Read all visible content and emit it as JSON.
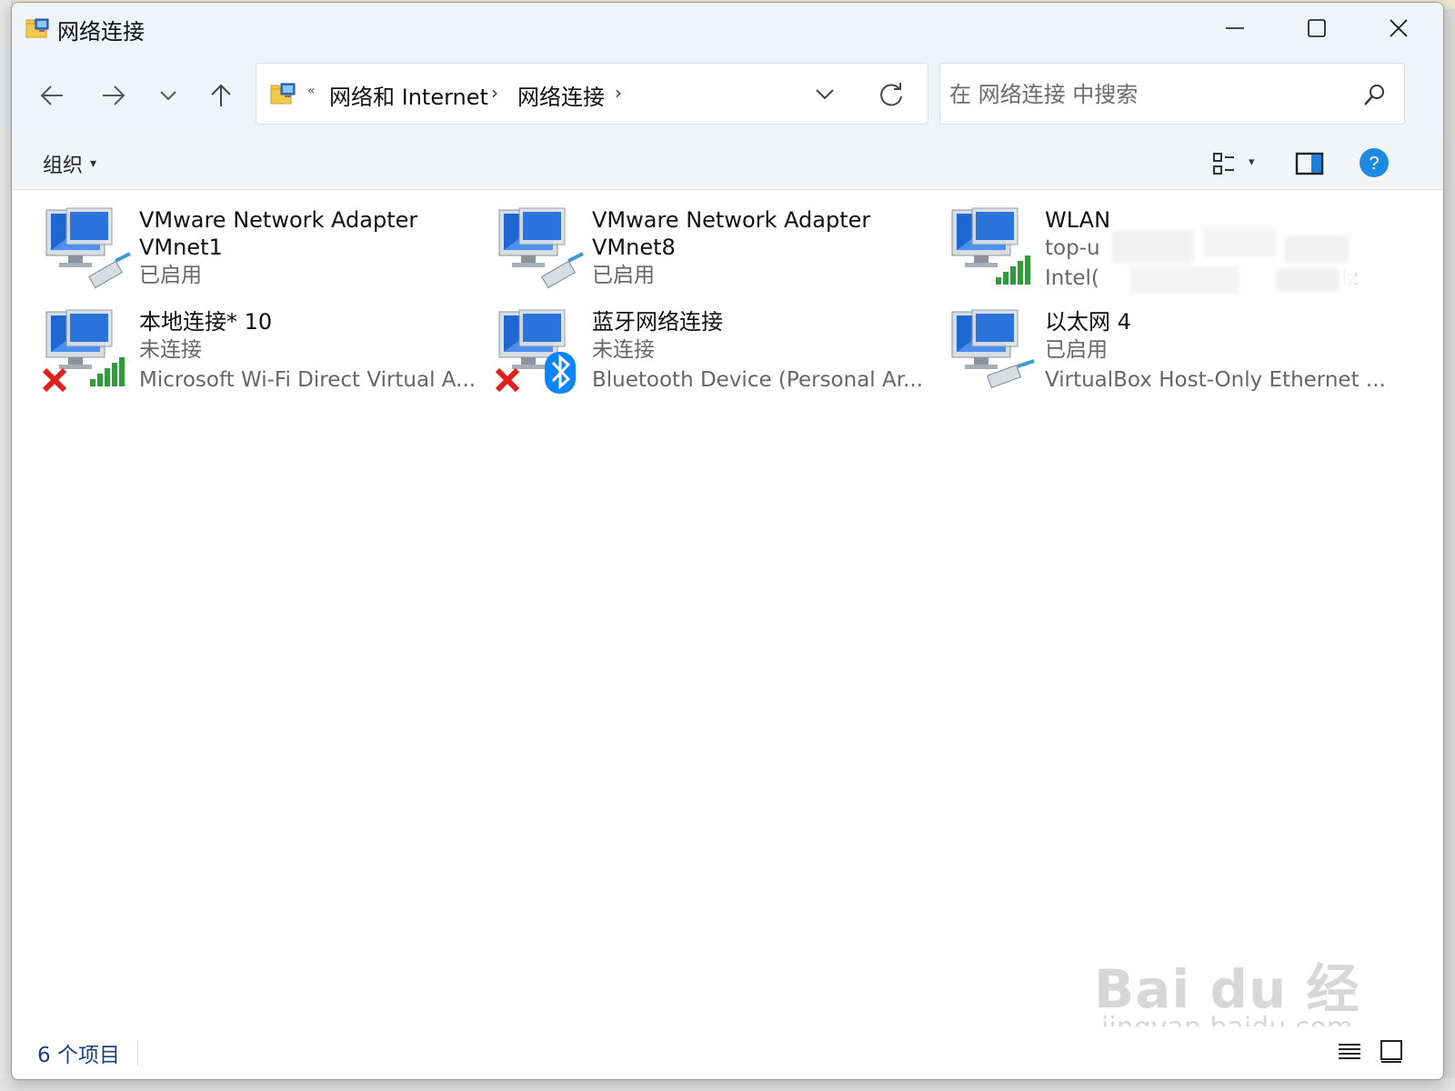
{
  "window": {
    "title": "网络连接"
  },
  "address_bar": {
    "overflow": "«",
    "breadcrumbs": [
      "网络和 Internet",
      "网络连接"
    ],
    "separator": "›"
  },
  "search": {
    "placeholder": "在 网络连接 中搜索"
  },
  "command_bar": {
    "organize_label": "组织",
    "organize_arrow": "▾",
    "view_arrow": "▾",
    "help_label": "?"
  },
  "connections": [
    {
      "name": "VMware Network Adapter VMnet1",
      "name_line1": "VMware Network Adapter",
      "name_line2": "VMnet1",
      "status": "已启用",
      "device": "",
      "icon": "network-cable-icon"
    },
    {
      "name": "VMware Network Adapter VMnet8",
      "name_line1": "VMware Network Adapter",
      "name_line2": "VMnet8",
      "status": "已启用",
      "device": "",
      "icon": "network-cable-icon"
    },
    {
      "name": "WLAN",
      "status": "top-u",
      "device": "Intel(",
      "device_tail": "lz",
      "icon": "wifi-signal-icon"
    },
    {
      "name": "本地连接* 10",
      "status": "未连接",
      "device": "Microsoft Wi-Fi Direct Virtual A...",
      "icon": "wifi-signal-icon",
      "disconnected": true
    },
    {
      "name": "蓝牙网络连接",
      "status": "未连接",
      "device": "Bluetooth Device (Personal Ar...",
      "icon": "bluetooth-icon",
      "disconnected": true
    },
    {
      "name": "以太网 4",
      "status": "已启用",
      "device": "VirtualBox Host-Only Ethernet ...",
      "icon": "network-cable-icon"
    }
  ],
  "status_bar": {
    "item_count": "6 个项目"
  },
  "watermark": {
    "main": "Bai du 经验",
    "sub": "jingyan.baidu.com"
  },
  "colors": {
    "title_bar": "#eff4f9",
    "accent": "#0a84ff",
    "help": "#1c8ae0",
    "status_text": "#1a3f7a",
    "error": "#e0201a",
    "signal": "#2e9e3a"
  }
}
